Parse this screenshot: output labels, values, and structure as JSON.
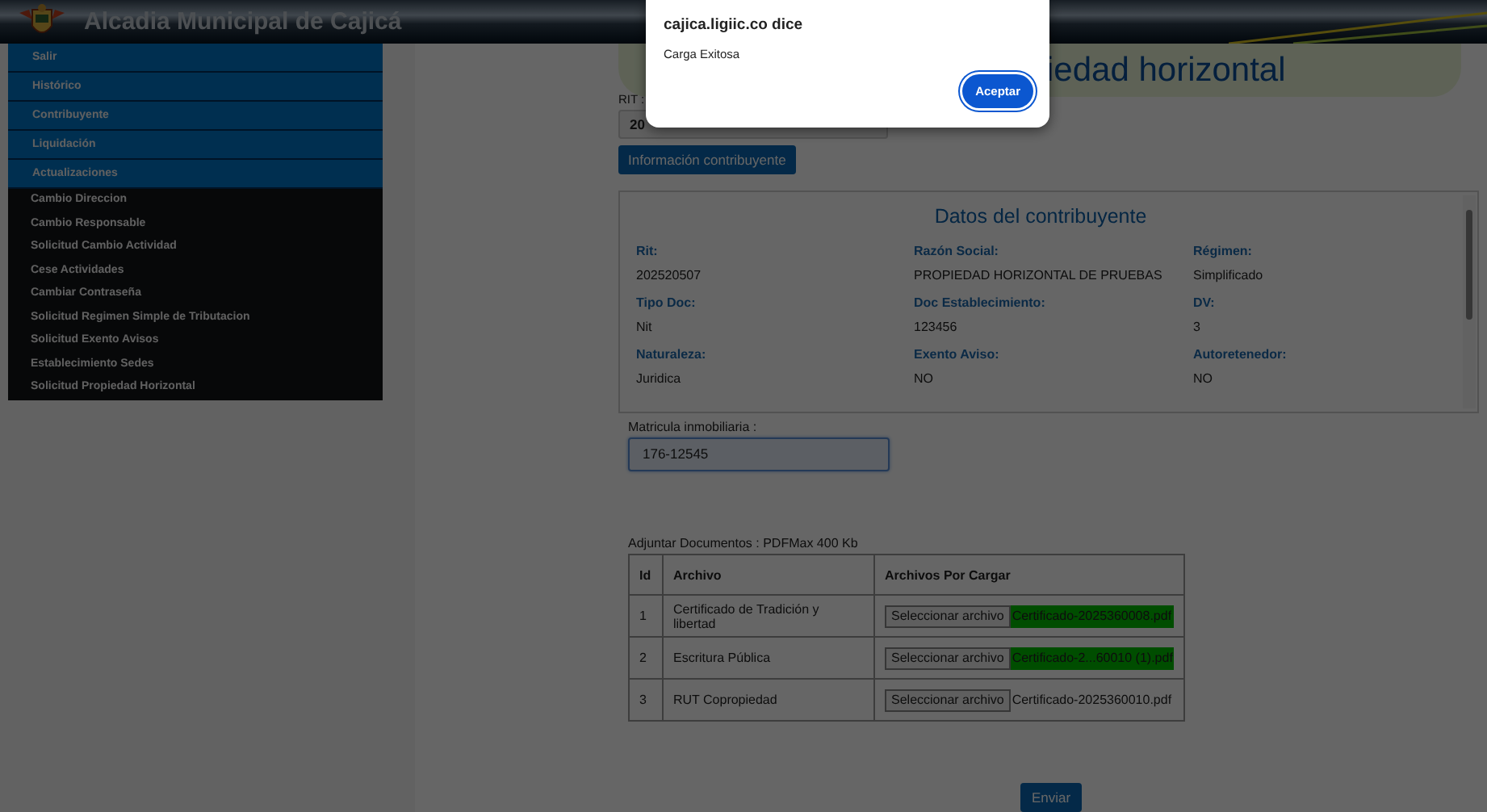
{
  "header": {
    "title": "Alcadia Municipal de Cajicá"
  },
  "menu": [
    {
      "label": "Salir"
    },
    {
      "label": "Histórico"
    },
    {
      "label": "Contribuyente"
    },
    {
      "label": "Liquidación"
    },
    {
      "label": "Actualizaciones",
      "children": [
        {
          "label": "Cambio Direccion"
        },
        {
          "label": "Cambio Responsable"
        },
        {
          "label": "Solicitud Cambio Actividad"
        },
        {
          "label": "Cese Actividades"
        },
        {
          "label": "Cambiar Contraseña"
        },
        {
          "label": "Solicitud Regimen Simple de Tributacion"
        },
        {
          "label": "Solicitud Exento Avisos"
        },
        {
          "label": "Establecimiento Sedes"
        },
        {
          "label": "Solicitud Propiedad Horizontal"
        }
      ]
    }
  ],
  "page_title": "iedad horizontal",
  "rit": {
    "label": "RIT :",
    "value": "20"
  },
  "info_button": "Información contribuyente",
  "contributor": {
    "title": "Datos del contribuyente",
    "fields": [
      {
        "label": "Rit:",
        "value": "202520507"
      },
      {
        "label": "Razón Social:",
        "value": "PROPIEDAD HORIZONTAL DE PRUEBAS"
      },
      {
        "label": "Régimen:",
        "value": "Simplificado"
      },
      {
        "label": "Tipo Doc:",
        "value": "Nit"
      },
      {
        "label": "Doc Establecimiento:",
        "value": "123456"
      },
      {
        "label": "DV:",
        "value": "3"
      },
      {
        "label": "Naturaleza:",
        "value": "Juridica"
      },
      {
        "label": "Exento Aviso:",
        "value": "NO"
      },
      {
        "label": "Autoretenedor:",
        "value": "NO"
      }
    ]
  },
  "matricula": {
    "label": "Matricula inmobiliaria :",
    "value": "176-12545",
    "focused": true
  },
  "attachments": {
    "label": "Adjuntar Documentos : PDFMax 400 Kb",
    "columns": [
      "Id",
      "Archivo",
      "Archivos Por Cargar"
    ],
    "rows": [
      {
        "id": "1",
        "archivo": "Certificado de Tradición y libertad",
        "button": "Seleccionar archivo",
        "file": "Certificado-2025360008.pdf",
        "uploaded": true
      },
      {
        "id": "2",
        "archivo": "Escritura Pública",
        "button": "Seleccionar archivo",
        "file": "Certificado-2...60010 (1).pdf",
        "uploaded": true
      },
      {
        "id": "3",
        "archivo": "RUT Copropiedad",
        "button": "Seleccionar archivo",
        "file": "Certificado-2025360010.pdf",
        "uploaded": false
      }
    ]
  },
  "submit": "Enviar",
  "dialog": {
    "title": "cajica.ligiic.co dice",
    "message": "Carga Exitosa",
    "button": "Aceptar"
  }
}
